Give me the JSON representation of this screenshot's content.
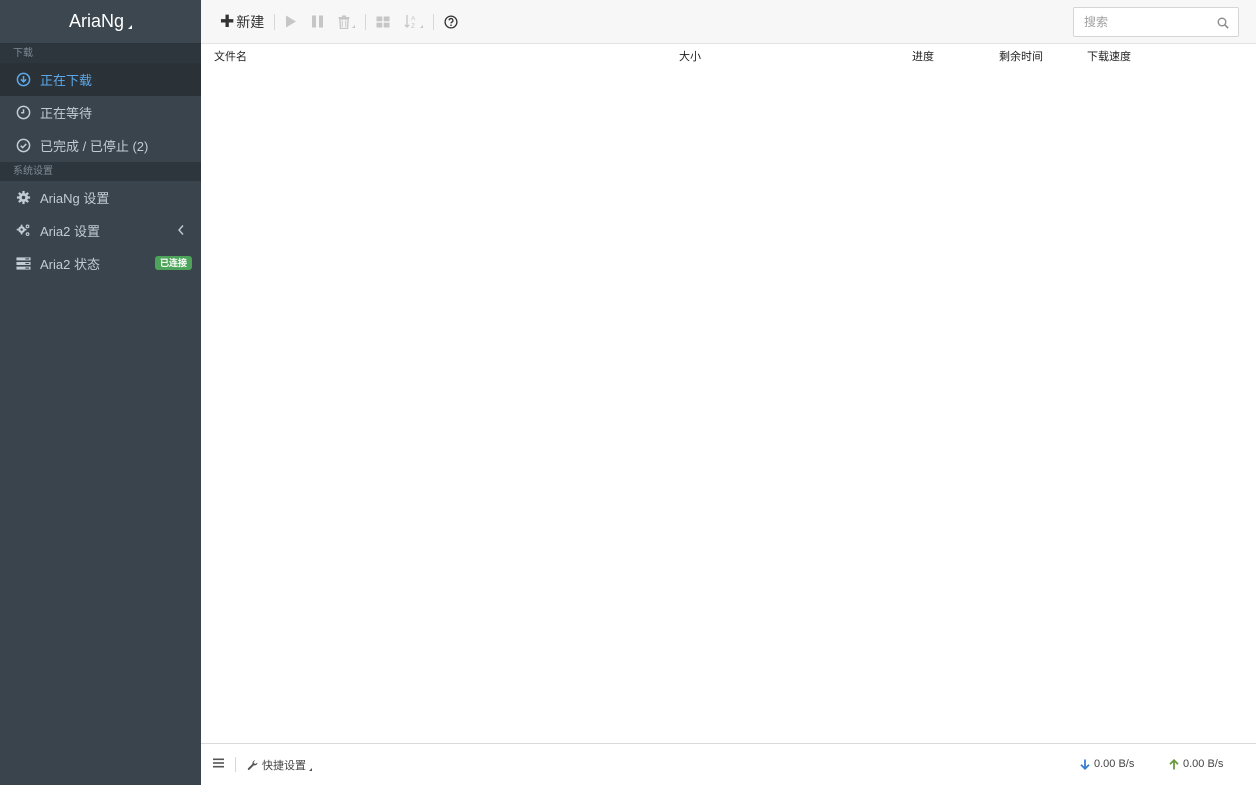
{
  "brand": {
    "title": "AriaNg"
  },
  "sidebar": {
    "download_header": "下载",
    "download_items": [
      {
        "label": "正在下载",
        "icon": "arrow-circle-down-icon",
        "active": true
      },
      {
        "label": "正在等待",
        "icon": "clock-icon",
        "active": false
      },
      {
        "label": "已完成 / 已停止 (2)",
        "icon": "check-circle-icon",
        "active": false
      }
    ],
    "settings_header": "系统设置",
    "settings_items": [
      {
        "label": "AriaNg 设置",
        "icon": "gear-icon"
      },
      {
        "label": "Aria2 设置",
        "icon": "gears-icon"
      },
      {
        "label": "Aria2 状态",
        "icon": "server-icon",
        "badge": "已连接"
      }
    ]
  },
  "toolbar": {
    "new_label": "新建",
    "search_placeholder": "搜索"
  },
  "table": {
    "columns": [
      "文件名",
      "大小",
      "进度",
      "剩余时间",
      "下载速度"
    ]
  },
  "footer": {
    "quick_settings_label": "快捷设置",
    "download_speed": "0.00 B/s",
    "upload_speed": "0.00 B/s"
  },
  "colors": {
    "sidebar_bg": "#3a444d",
    "active_item": "#5ba9ea",
    "badge_green": "#4da35a",
    "download_arrow": "#3a7fd1",
    "upload_arrow": "#6a9a3a"
  }
}
